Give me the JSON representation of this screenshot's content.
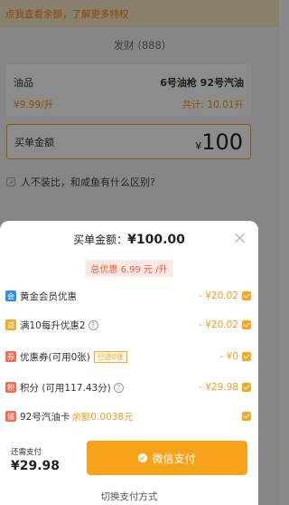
{
  "background": {
    "notice": "点我查看余额，了解更多特权",
    "station_name": "发财 (888)",
    "fuel_label": "油品",
    "fuel_gun": "6号油枪 92号汽油",
    "unit_price": "¥9.99/升",
    "total": "共计: 10.01升",
    "amount_label": "买单金额",
    "amount_currency": "¥",
    "amount_value": "100",
    "question": "人不装比，和咸鱼有什么区别?"
  },
  "sheet": {
    "title_prefix": "买单金额：",
    "title_amount": "¥100.00",
    "total_discount": "总优惠 6.99 元 /升",
    "items": [
      {
        "badge": "会",
        "badge_color": "#2d8cf0",
        "label": "黄金会员优惠",
        "value": "- ¥20.02",
        "checked": true
      },
      {
        "badge": "减",
        "badge_color": "#f5a623",
        "label": "满10每升优惠2",
        "value": "- ¥20.02",
        "checked": true,
        "help": "?"
      },
      {
        "badge": "券",
        "badge_color": "#f26c4f",
        "label": "优惠券(可用0张)",
        "tag": "已选0张",
        "value": "- ¥0",
        "checked": true
      },
      {
        "badge": "积",
        "badge_color": "#f26c4f",
        "label": "积分 (可用117.43分)",
        "value": "- ¥29.98",
        "checked": true,
        "help": "?"
      },
      {
        "badge": "储",
        "badge_color": "#f26c4f",
        "label": "92号汽油卡",
        "sub": "余额0.0038元",
        "value": "",
        "checked": true
      }
    ],
    "pay_label": "还需支付",
    "pay_amount": "¥29.98",
    "pay_button": "微信支付",
    "switch_method": "切换支付方式"
  }
}
